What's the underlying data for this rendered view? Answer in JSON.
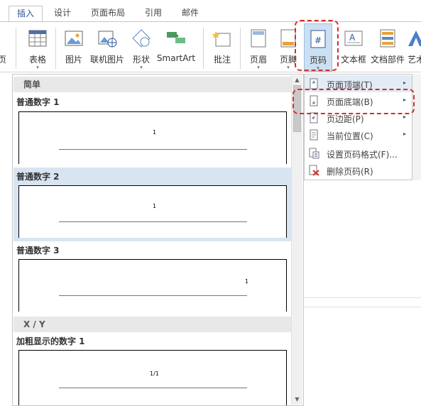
{
  "tabs": [
    {
      "label": "插入",
      "active": true
    },
    {
      "label": "设计"
    },
    {
      "label": "页面布局"
    },
    {
      "label": "引用"
    },
    {
      "label": "邮件"
    }
  ],
  "ribbon": {
    "partial_left": "页",
    "table": "表格",
    "picture": "图片",
    "online_picture": "联机图片",
    "shapes": "形状",
    "smartart": "SmartArt",
    "comment": "批注",
    "header": "页眉",
    "footer": "页脚",
    "page_number": "页码",
    "textbox": "文本框",
    "quick_parts": "文档部件",
    "wordart_partial": "艺术",
    "page_number_icon_glyph": "#",
    "textbox_icon_glyph": "A"
  },
  "gallery": {
    "section_simple": "简单",
    "section_xy": "X / Y",
    "items": [
      {
        "label": "普通数字 1",
        "preview": "1"
      },
      {
        "label": "普通数字 2",
        "preview": "1"
      },
      {
        "label": "普通数字 3",
        "preview": "1"
      },
      {
        "label": "加粗显示的数字 1",
        "preview": "1/1"
      }
    ]
  },
  "menu": {
    "items": [
      {
        "label": "页面顶端(T)",
        "submenu": true
      },
      {
        "label": "页面底端(B)",
        "submenu": true
      },
      {
        "label": "页边距(P)",
        "submenu": true
      },
      {
        "label": "当前位置(C)",
        "submenu": true
      },
      {
        "label": "设置页码格式(F)...",
        "submenu": false
      },
      {
        "label": "删除页码(R)",
        "submenu": false
      }
    ]
  },
  "colors": {
    "accent": "#2b579a",
    "highlight_red": "#d62b2b",
    "selected_item_bg": "#d9e4f2",
    "button_active_bg": "#cde0f2"
  },
  "icons": {
    "submenu_arrow": "▸",
    "dropdown_arrow": "▾",
    "scroll_up": "▲",
    "scroll_down": "▼"
  }
}
